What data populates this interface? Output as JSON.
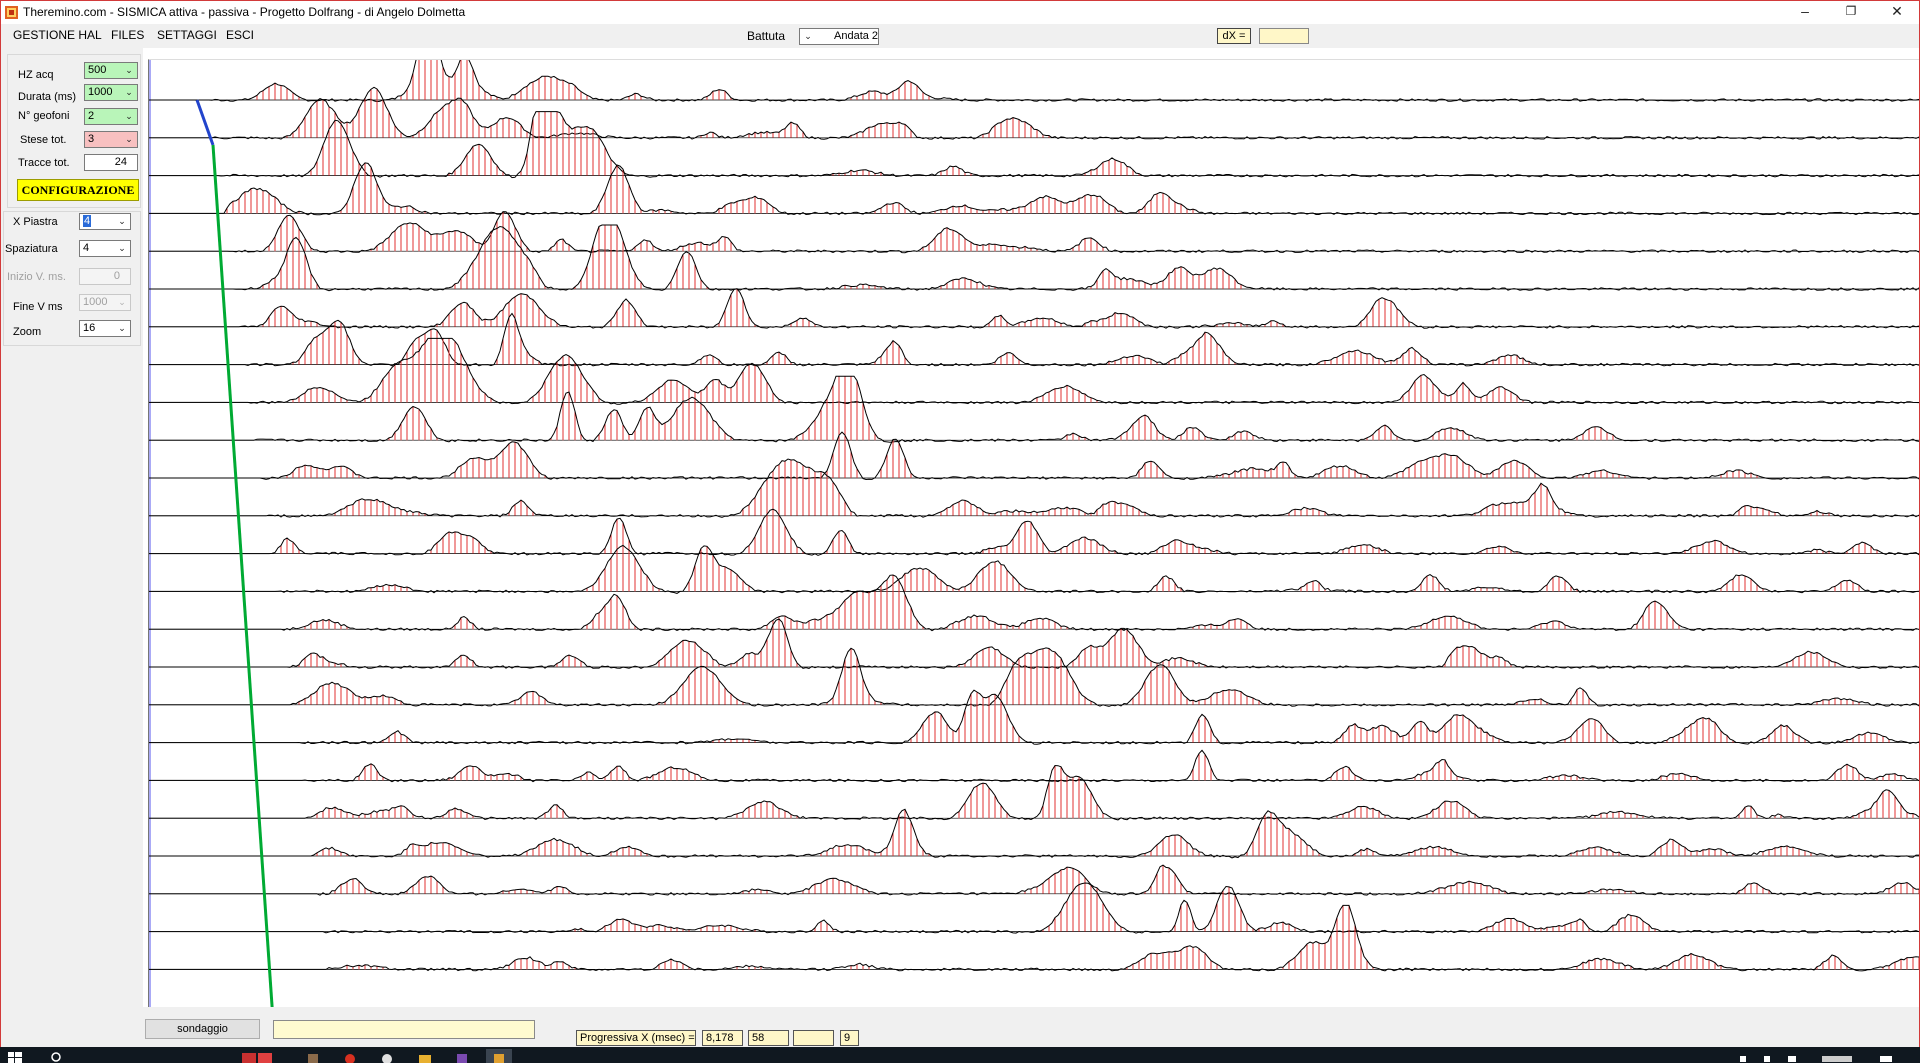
{
  "window": {
    "title": "Theremino.com - SISMICA attiva - passiva - Progetto Dolfrang -  di Angelo Dolmetta",
    "controls": {
      "minimize": "–",
      "maximize": "❐",
      "close": "✕"
    }
  },
  "menu": {
    "items": [
      "GESTIONE HAL",
      "FILES",
      "SETTAGGI",
      "ESCI"
    ]
  },
  "toolbar": {
    "battuta_label": "Battuta",
    "battuta_value": "Andata 2",
    "dx_label": "dX =",
    "dx_value": ""
  },
  "config": {
    "hz_acq_label": "HZ acq",
    "hz_acq_value": "500",
    "durata_label": "Durata (ms)",
    "durata_value": "1000",
    "geofoni_label": "N° geofoni",
    "geofoni_value": "2",
    "stese_label": "Stese tot.",
    "stese_value": "3",
    "tracce_label": "Tracce tot.",
    "tracce_value": "24",
    "button_label": "CONFIGURAZIONE"
  },
  "view": {
    "x_piastra_label": "X Piastra",
    "x_piastra_value": "4",
    "spaziatura_label": "Spaziatura",
    "spaziatura_value": "4",
    "inizio_label": "Inizio V. ms.",
    "inizio_value": "0",
    "fine_label": "Fine V ms",
    "fine_value": "1000",
    "zoom_label": "Zoom",
    "zoom_value": "16"
  },
  "bottom": {
    "sondaggio_button": "sondaggio",
    "status_text": "",
    "progressiva_label": "Progressiva X (msec) =",
    "progressiva_value": "8,178",
    "value2": "58",
    "value3": "",
    "value4": "9"
  },
  "colors": {
    "trace": "#000000",
    "fill": "#e03030",
    "first_break_line": "#00aa33",
    "first_break_start": "#2244cc",
    "marker_line": "#5555ee",
    "highlight_yellow": "#ffff00",
    "field_green": "#b9f5b9",
    "field_pink": "#f8c0c0"
  }
}
